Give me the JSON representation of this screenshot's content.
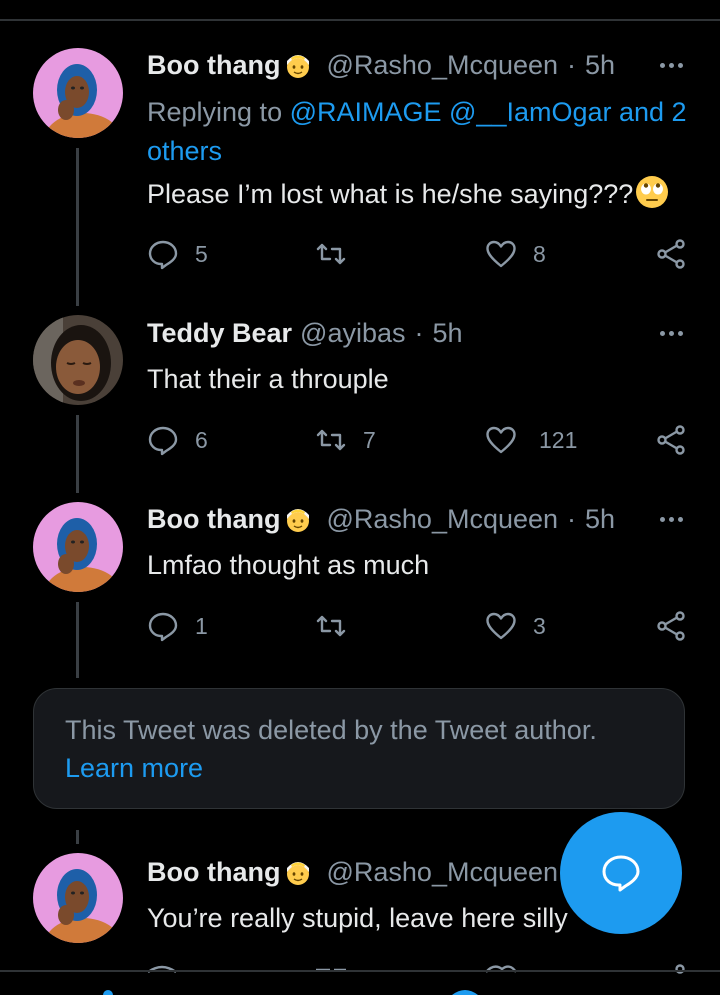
{
  "tweets": [
    {
      "name": "Boo thang",
      "name_emoji": "person-with-veil",
      "handle": "@Rasho_Mcqueen",
      "time": "5h",
      "replying_prefix": "Replying to ",
      "replying_mentions": "@RAIMAGE @__IamOgar and 2 others",
      "text": "Please I’m lost what is he/she saying???",
      "text_emoji": "rolling-eyes",
      "replies": "5",
      "retweets": "",
      "likes": "8"
    },
    {
      "name": "Teddy Bear",
      "handle": "@ayibas",
      "time": "5h",
      "text": "That their a throuple",
      "replies": "6",
      "retweets": "7",
      "likes": "121"
    },
    {
      "name": "Boo thang",
      "name_emoji": "person-with-veil",
      "handle": "@Rasho_Mcqueen",
      "time": "5h",
      "text": "Lmfao thought as much",
      "replies": "1",
      "retweets": "",
      "likes": "3"
    },
    {
      "name": "Boo thang",
      "name_emoji": "person-with-veil",
      "handle": "@Rasho_Mcqueen",
      "time": "",
      "text": "You’re really stupid, leave here silly"
    }
  ],
  "deleted_notice": {
    "text": "This Tweet was deleted by the Tweet author.",
    "link": "Learn more"
  },
  "separator": "·",
  "compose_button": {
    "icon": "compose-reply-icon"
  },
  "colors": {
    "background": "#000000",
    "accent": "#1d9bf0",
    "secondary_text": "#8b98a5",
    "primary_text": "#e7e9ea",
    "card_background": "#16181c"
  }
}
